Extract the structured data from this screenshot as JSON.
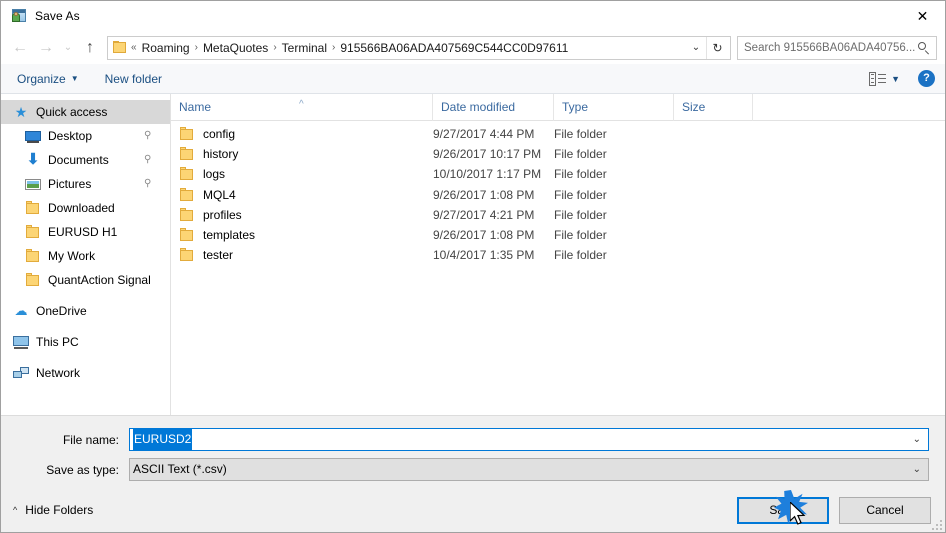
{
  "window": {
    "title": "Save As",
    "icon": "save-as-app-icon",
    "close_label": "✕"
  },
  "navigation": {
    "back_icon": "←",
    "forward_icon": "→",
    "recent_icon": "⌄",
    "up_icon": "↑",
    "breadcrumb_prefix": "«",
    "breadcrumbs": [
      "Roaming",
      "MetaQuotes",
      "Terminal",
      "915566BA06ADA407569C544CC0D97611"
    ],
    "separator": "›",
    "dropdown_icon": "⌄",
    "refresh_icon": "↻"
  },
  "search": {
    "placeholder": "Search 915566BA06ADA40756...",
    "value": ""
  },
  "toolbar": {
    "organize_label": "Organize",
    "organize_caret": "▼",
    "new_folder_label": "New folder",
    "view_caret": "▼",
    "help_label": "?"
  },
  "sidebar": {
    "items": [
      {
        "label": "Quick access",
        "icon": "star-icon",
        "selected": true,
        "pinned": false,
        "root": true
      },
      {
        "label": "Desktop",
        "icon": "desktop-icon",
        "selected": false,
        "pinned": true,
        "root": false
      },
      {
        "label": "Documents",
        "icon": "download-arrow-icon",
        "selected": false,
        "pinned": true,
        "root": false
      },
      {
        "label": "Pictures",
        "icon": "pictures-icon",
        "selected": false,
        "pinned": true,
        "root": false
      },
      {
        "label": "Downloaded",
        "icon": "folder-icon",
        "selected": false,
        "pinned": false,
        "root": false
      },
      {
        "label": "EURUSD H1",
        "icon": "folder-icon",
        "selected": false,
        "pinned": false,
        "root": false
      },
      {
        "label": "My Work",
        "icon": "folder-icon",
        "selected": false,
        "pinned": false,
        "root": false
      },
      {
        "label": "QuantAction Signal",
        "icon": "folder-icon",
        "selected": false,
        "pinned": false,
        "root": false
      },
      {
        "label": "OneDrive",
        "icon": "cloud-icon",
        "selected": false,
        "pinned": false,
        "root": true
      },
      {
        "label": "This PC",
        "icon": "computer-icon",
        "selected": false,
        "pinned": false,
        "root": true
      },
      {
        "label": "Network",
        "icon": "network-icon",
        "selected": false,
        "pinned": false,
        "root": true
      }
    ],
    "pin_icon": "📌"
  },
  "filelist": {
    "columns": [
      "Name",
      "Date modified",
      "Type",
      "Size"
    ],
    "sort_caret": "^",
    "rows": [
      {
        "name": "config",
        "date": "9/27/2017 4:44 PM",
        "type": "File folder",
        "size": ""
      },
      {
        "name": "history",
        "date": "9/26/2017 10:17 PM",
        "type": "File folder",
        "size": ""
      },
      {
        "name": "logs",
        "date": "10/10/2017 1:17 PM",
        "type": "File folder",
        "size": ""
      },
      {
        "name": "MQL4",
        "date": "9/26/2017 1:08 PM",
        "type": "File folder",
        "size": ""
      },
      {
        "name": "profiles",
        "date": "9/27/2017 4:21 PM",
        "type": "File folder",
        "size": ""
      },
      {
        "name": "templates",
        "date": "9/26/2017 1:08 PM",
        "type": "File folder",
        "size": ""
      },
      {
        "name": "tester",
        "date": "10/4/2017 1:35 PM",
        "type": "File folder",
        "size": ""
      }
    ]
  },
  "form": {
    "filename_label": "File name:",
    "filename_value": "EURUSD2",
    "filetype_label": "Save as type:",
    "filetype_value": "ASCII Text (*.csv)",
    "chevron": "⌄"
  },
  "footer": {
    "hide_folders_label": "Hide Folders",
    "hide_folders_caret": "^",
    "save_label": "Save",
    "cancel_label": "Cancel"
  },
  "colors": {
    "accent": "#0078d7",
    "link_blue": "#1b4f82",
    "folder_yellow": "#fcd575",
    "selection": "#d8d8d8"
  }
}
